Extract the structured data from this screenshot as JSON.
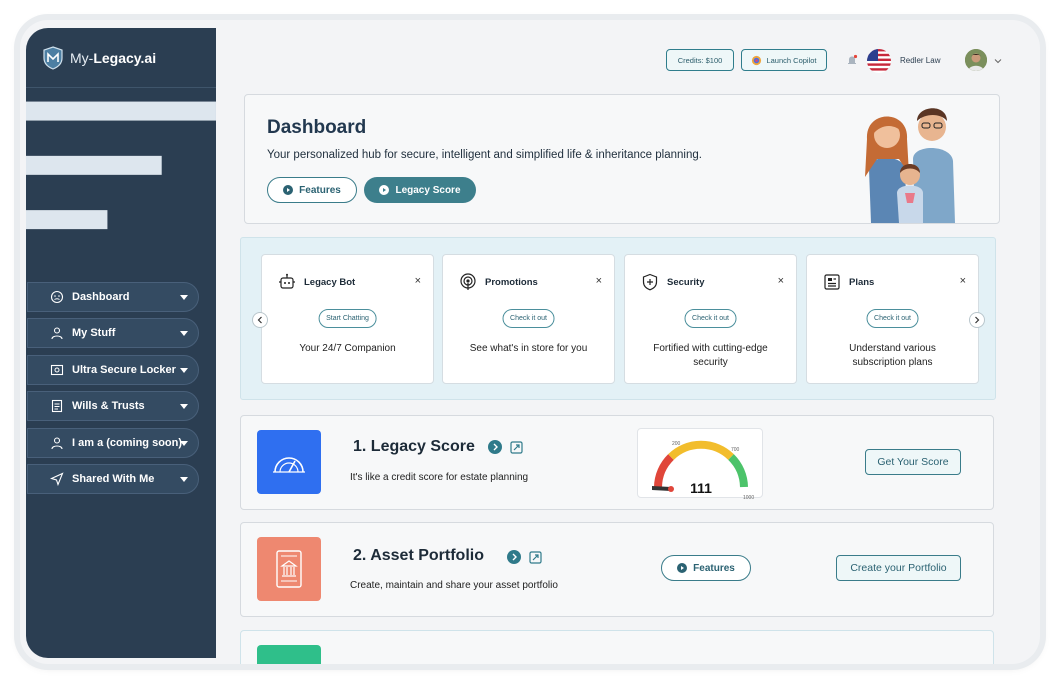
{
  "brand": {
    "prefix": "My-",
    "name": "Legacy.ai"
  },
  "sidebar": {
    "items": [
      {
        "label": "Dashboard",
        "icon": "face-icon"
      },
      {
        "label": "My Stuff",
        "icon": "person-icon"
      },
      {
        "label": "Ultra Secure Locker",
        "icon": "locker-icon"
      },
      {
        "label": "Wills & Trusts",
        "icon": "document-icon"
      },
      {
        "label": "I am a (coming soon)",
        "icon": "person-icon"
      },
      {
        "label": "Shared With Me",
        "icon": "send-icon"
      }
    ]
  },
  "topbar": {
    "credits": "Credits: $100",
    "copilot": "Launch Copilot",
    "user_name": "Redler Law"
  },
  "hero": {
    "title": "Dashboard",
    "subtitle": "Your personalized hub for secure, intelligent and simplified life & inheritance planning.",
    "features_btn": "Features",
    "score_btn": "Legacy Score"
  },
  "cards": [
    {
      "title": "Legacy Bot",
      "button": "Start Chatting",
      "desc": "Your 24/7 Companion",
      "icon": "robot-icon"
    },
    {
      "title": "Promotions",
      "button": "Check it out",
      "desc": "See what's in store for you",
      "icon": "broadcast-icon"
    },
    {
      "title": "Security",
      "button": "Check it out",
      "desc": "Fortified with cutting-edge security",
      "icon": "shield-icon"
    },
    {
      "title": "Plans",
      "button": "Check it out",
      "desc": "Understand various subscription plans",
      "icon": "plans-icon"
    }
  ],
  "close_glyph": "×",
  "rows": [
    {
      "title": "1. Legacy Score",
      "subtitle": "It's like a credit score for estate planning",
      "action": "Get Your Score",
      "tile_color": "#2f6ff0"
    },
    {
      "title": "2. Asset Portfolio",
      "subtitle": "Create, maintain and share your asset portfolio",
      "features": "Features",
      "action": "Create your Portfolio",
      "tile_color": "#ee8870"
    }
  ],
  "gauge": {
    "value": "111",
    "tick_200": "200",
    "tick_700": "700",
    "tick_1000": "1000",
    "level": 0.11
  },
  "colors": {
    "sidebar": "#2b3e52",
    "accent": "#3d7f8c",
    "gauge_red": "#e0463a",
    "gauge_yellow": "#f2bd2c",
    "gauge_green": "#4cc36a",
    "row3_tile": "#2fbf8a"
  }
}
